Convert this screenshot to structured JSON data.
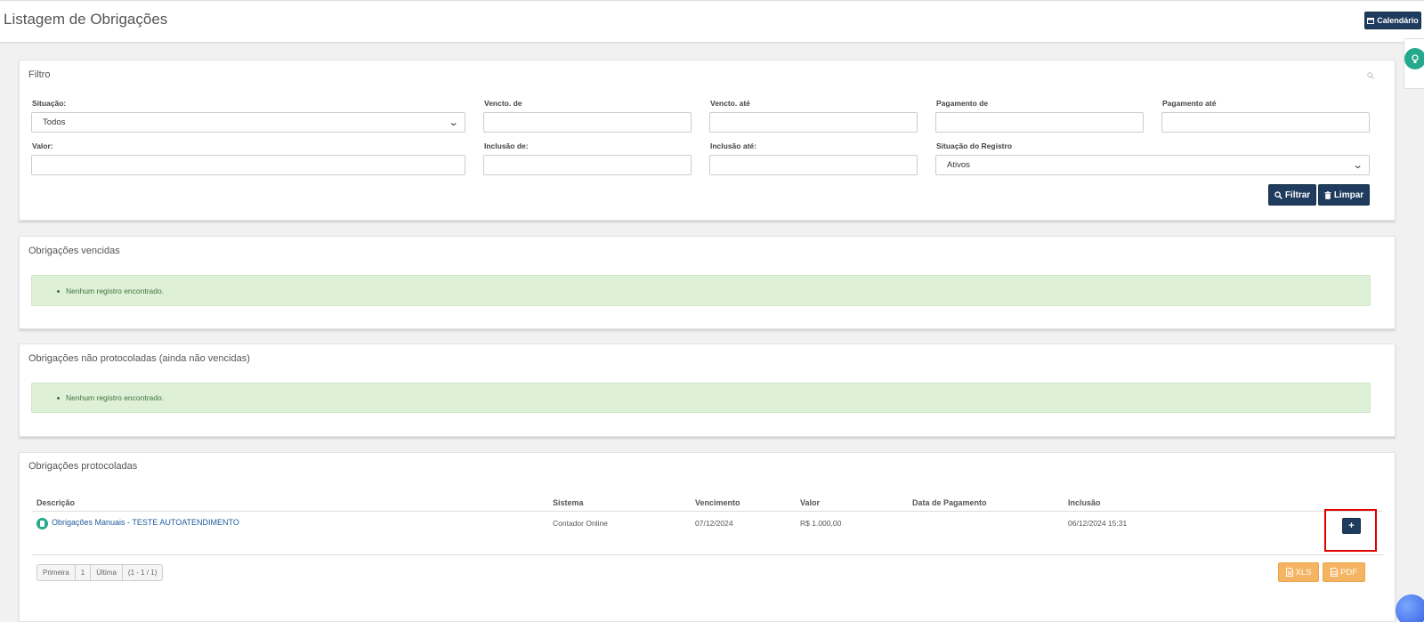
{
  "header": {
    "title": "Listagem de Obrigações",
    "calendar_label": "Calendário"
  },
  "filter": {
    "title": "Filtro",
    "situacao_label": "Situação:",
    "situacao_value": "Todos",
    "vencto_de_label": "Vencto. de",
    "vencto_ate_label": "Vencto. até",
    "pagamento_de_label": "Pagamento de",
    "pagamento_ate_label": "Pagamento até",
    "valor_label": "Valor:",
    "inclusao_de_label": "Inclusão de:",
    "inclusao_ate_label": "Inclusão até:",
    "situacao_registro_label": "Situação do Registro",
    "situacao_registro_value": "Ativos",
    "filter_button": "Filtrar",
    "clear_button": "Limpar"
  },
  "vencidas": {
    "title": "Obrigações vencidas",
    "empty_message": "Nenhum registro encontrado."
  },
  "nao_protocoladas": {
    "title": "Obrigações não protocoladas (ainda não vencidas)",
    "empty_message": "Nenhum registro encontrado."
  },
  "protocoladas": {
    "title": "Obrigações protocoladas",
    "columns": {
      "descricao": "Descrição",
      "sistema": "Sistema",
      "vencimento": "Vencimento",
      "valor": "Valor",
      "data_pagamento": "Data de Pagamento",
      "inclusao": "Inclusão"
    },
    "rows": [
      {
        "descricao": "Obrigações Manuais - TESTE AUTOATENDIMENTO",
        "sistema": "Contador Online",
        "vencimento": "07/12/2024",
        "valor": "R$ 1.000,00",
        "data_pagamento": "",
        "inclusao": "06/12/2024 15:31"
      }
    ],
    "action_plus": "+",
    "pagination": {
      "first": "Primeira",
      "page": "1",
      "last": "Última",
      "range": "(1 - 1 / 1)"
    },
    "xls_label": "XLS",
    "pdf_label": "PDF"
  },
  "colors": {
    "primary": "#1f3b5d",
    "success_bg": "#dff0d8",
    "export_orange": "#f5b461",
    "highlight": "#e00000",
    "teal": "#25a98c"
  },
  "icons": {
    "calendar": "calendar-icon",
    "search": "search-icon",
    "trash": "trash-icon",
    "file_excel": "file-excel-icon",
    "file_pdf": "file-pdf-icon",
    "lightbulb": "lightbulb-icon",
    "document": "document-icon",
    "plus": "plus-icon"
  }
}
